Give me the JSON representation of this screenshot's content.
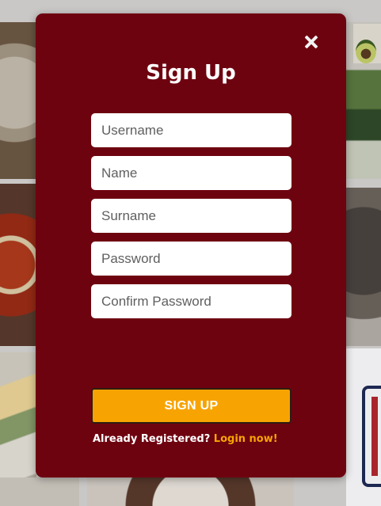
{
  "modal": {
    "title": "Sign Up",
    "close_icon": "close-icon",
    "fields": {
      "username_placeholder": "Username",
      "name_placeholder": "Name",
      "surname_placeholder": "Surname",
      "password_placeholder": "Password",
      "confirm_password_placeholder": "Confirm Password"
    },
    "signup_label": "SIGN UP",
    "already_text": "Already Registered?",
    "login_link": "Login now!"
  },
  "colors": {
    "modal_bg": "#6e0310",
    "button_bg": "#f7a402",
    "link": "#f7a402"
  }
}
